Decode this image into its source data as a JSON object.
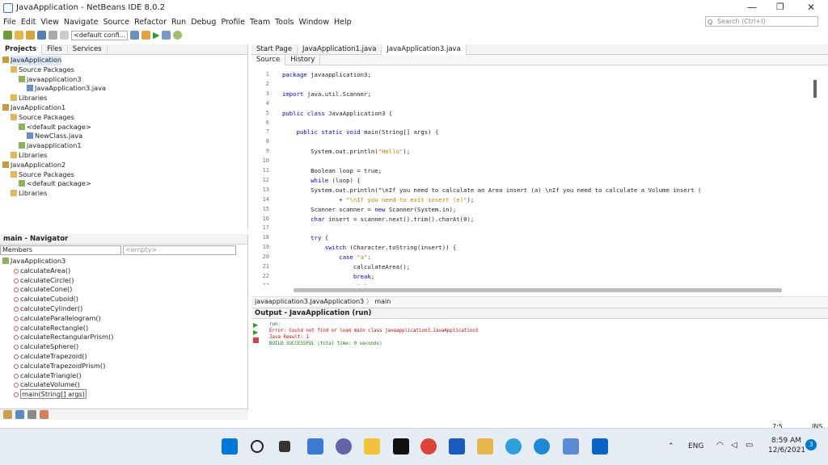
{
  "window": {
    "title": "JavaApplication - NetBeans IDE 8.0.2"
  },
  "menu": [
    "File",
    "Edit",
    "View",
    "Navigate",
    "Source",
    "Refactor",
    "Run",
    "Debug",
    "Profile",
    "Team",
    "Tools",
    "Window",
    "Help"
  ],
  "search": {
    "placeholder": "Search (Ctrl+I)"
  },
  "toolbar": {
    "config": "<default confi..."
  },
  "projects": {
    "tabs": [
      "Projects",
      "Files",
      "Services"
    ],
    "tree": [
      {
        "label": "JavaApplication",
        "indent": 0,
        "sel": true
      },
      {
        "label": "Source Packages",
        "indent": 1
      },
      {
        "label": "javaapplication3",
        "indent": 2
      },
      {
        "label": "JavaApplication3.java",
        "indent": 3
      },
      {
        "label": "Libraries",
        "indent": 1
      },
      {
        "label": "JavaApplication1",
        "indent": 0
      },
      {
        "label": "Source Packages",
        "indent": 1
      },
      {
        "label": "<default package>",
        "indent": 2
      },
      {
        "label": "NewClass.java",
        "indent": 3
      },
      {
        "label": "javaapplication1",
        "indent": 2
      },
      {
        "label": "Libraries",
        "indent": 1
      },
      {
        "label": "JavaApplication2",
        "indent": 0
      },
      {
        "label": "Source Packages",
        "indent": 1
      },
      {
        "label": "<default package>",
        "indent": 2
      },
      {
        "label": "Libraries",
        "indent": 1
      }
    ]
  },
  "navigator": {
    "title": "main - Navigator",
    "filter": "Members",
    "filter2": "<empty>",
    "root": "JavaApplication3",
    "members": [
      "calculateArea()",
      "calculateCircle()",
      "calculateCone()",
      "calculateCuboid()",
      "calculateCylinder()",
      "calculateParallelogram()",
      "calculateRectangle()",
      "calculateRectangularPrism()",
      "calculateSphere()",
      "calculateTrapezoid()",
      "calculateTrapezoidPrism()",
      "calculateTriangle()",
      "calculateVolume()",
      "main(String[] args)"
    ]
  },
  "editor": {
    "tabs": [
      "Start Page",
      "JavaApplication1.java",
      "JavaApplication3.java"
    ],
    "subtabs": [
      "Source",
      "History"
    ],
    "breadcrumb": [
      "javaapplication3.JavaApplication3",
      "main"
    ],
    "lines": [
      {
        "n": "1",
        "t": "package javaapplication3;"
      },
      {
        "n": "2",
        "t": ""
      },
      {
        "n": "3",
        "t": "import java.util.Scanner;"
      },
      {
        "n": "4",
        "t": ""
      },
      {
        "n": "5",
        "t": "public class JavaApplication3 {"
      },
      {
        "n": "6",
        "t": ""
      },
      {
        "n": "7",
        "t": "    public static void main(String[] args) {"
      },
      {
        "n": "8",
        "t": ""
      },
      {
        "n": "9",
        "t": "        System.out.println(\"Hello\");"
      },
      {
        "n": "10",
        "t": ""
      },
      {
        "n": "11",
        "t": "        Boolean loop = true;"
      },
      {
        "n": "12",
        "t": "        while (loop) {"
      },
      {
        "n": "13",
        "t": "        System.out.println(\"\\nIf you need to calculate an Area insert (a) \\nIf you need to calculate a Volume insert ("
      },
      {
        "n": "14",
        "t": "                + \"\\nIf you need to exit insert (e)\");"
      },
      {
        "n": "15",
        "t": "        Scanner scanner = new Scanner(System.in);"
      },
      {
        "n": "16",
        "t": "        char insert = scanner.next().trim().charAt(0);"
      },
      {
        "n": "17",
        "t": ""
      },
      {
        "n": "18",
        "t": "        try {"
      },
      {
        "n": "19",
        "t": "            switch (Character.toString(insert)) {"
      },
      {
        "n": "20",
        "t": "                case \"a\":"
      },
      {
        "n": "21",
        "t": "                    calculateArea();"
      },
      {
        "n": "22",
        "t": "                    break;"
      },
      {
        "n": "23",
        "t": "                case \"v\":"
      }
    ]
  },
  "output": {
    "title": "Output - JavaApplication (run)",
    "lines": [
      "run:",
      "Error: Could not find or load main class javaapplication3.JavaApplication3",
      "Java Result: 1",
      "BUILD SUCCESSFUL (total time: 0 seconds)"
    ]
  },
  "status": {
    "position": "7:5",
    "mode": "INS"
  },
  "taskbar": {
    "lang": "ENG",
    "time": "8:59 AM",
    "date": "12/6/2021",
    "badge": "3"
  },
  "colors": {
    "accent": "#3a6fb0",
    "keyword": "#0000e6",
    "string": "#ce7b00",
    "error": "#d00000",
    "success": "#1a7a1a"
  }
}
